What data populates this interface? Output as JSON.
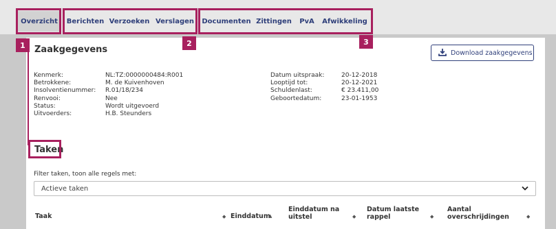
{
  "tabs": {
    "overzicht": "Overzicht",
    "berichten": "Berichten",
    "verzoeken": "Verzoeken",
    "verslagen": "Verslagen",
    "documenten": "Documenten",
    "zittingen": "Zittingen",
    "pva": "PvA",
    "afwikkeling": "Afwikkeling"
  },
  "callouts": {
    "one": "1",
    "two": "2",
    "three": "3"
  },
  "zaak": {
    "title": "Zaakgegevens",
    "download_label": "Download zaakgegevens",
    "left_labels": [
      "Kenmerk:",
      "Betrokkene:",
      "Insolventienummer:",
      "Renvooi:",
      "Status:",
      "Uitvoerders:"
    ],
    "left_values": [
      "NL:TZ:0000000484:R001",
      "M. de Kuivenhoven",
      "R.01/18/234",
      "Nee",
      "Wordt uitgevoerd",
      "H.B. Steunders"
    ],
    "right_labels": [
      "Datum uitspraak:",
      "Looptijd tot:",
      "Schuldenlast:",
      "Geboortedatum:"
    ],
    "right_values": [
      "20-12-2018",
      "20-12-2021",
      "€ 23.411,00",
      "23-01-1953"
    ]
  },
  "taken": {
    "title": "Taken",
    "filter_label": "Filter taken, toon alle regels met:",
    "filter_value": "Actieve taken",
    "columns": {
      "taak": "Taak",
      "einddatum": "Einddatum",
      "einddatum_uitstel_1": "Einddatum na",
      "einddatum_uitstel_2": "uitstel",
      "rappel_1": "Datum laatste",
      "rappel_2": "rappel",
      "overschr_1": "Aantal",
      "overschr_2": "overschrijdingen"
    }
  },
  "colors": {
    "accent": "#a8205e",
    "primary": "#2f3f7a"
  }
}
